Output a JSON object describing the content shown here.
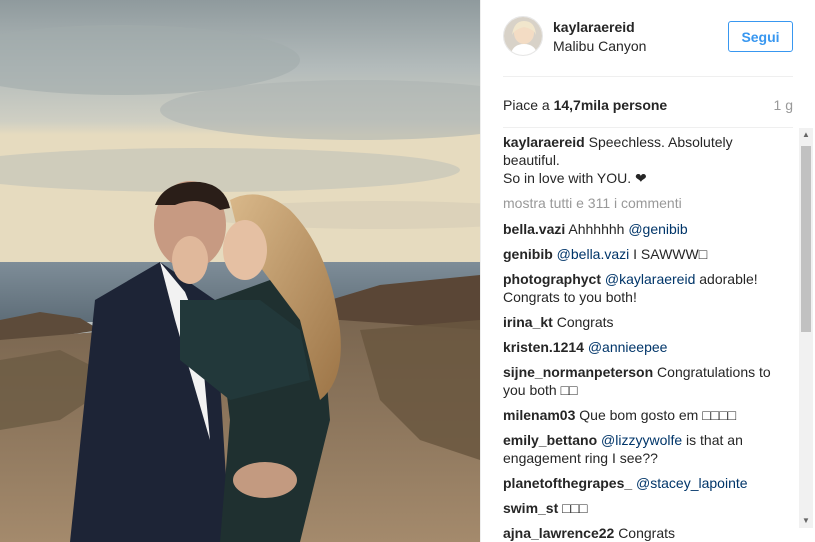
{
  "header": {
    "username": "kaylaraereid",
    "location": "Malibu Canyon",
    "follow_label": "Segui"
  },
  "likes": {
    "prefix": "Piace a ",
    "count": "14,7",
    "suffix": "mila persone",
    "time": "1 g"
  },
  "caption": {
    "user": "kaylaraereid",
    "line1": "Speechless. Absolutely beautiful.",
    "line2": "So in love with YOU.",
    "heart": "❤"
  },
  "show_all_label": "mostra tutti e 311 i commenti",
  "comments": [
    {
      "user": "bella.vazi",
      "text": "Ahhhhhh ",
      "mention": "@genibib",
      "after": ""
    },
    {
      "user": "genibib",
      "text": "",
      "mention": "@bella.vazi",
      "after": " I SAWWW□"
    },
    {
      "user": "photographyct",
      "text": "",
      "mention": "@kaylaraereid",
      "after": " adorable! Congrats to you both!"
    },
    {
      "user": "irina_kt",
      "text": "Congrats",
      "mention": "",
      "after": ""
    },
    {
      "user": "kristen.1214",
      "text": "",
      "mention": "@annieepee",
      "after": ""
    },
    {
      "user": "sijne_normanpeterson",
      "text": "Congratulations to you both □□",
      "mention": "",
      "after": ""
    },
    {
      "user": "milenam03",
      "text": "Que bom gosto em □□□□",
      "mention": "",
      "after": ""
    },
    {
      "user": "emily_bettano",
      "text": "",
      "mention": "@lizzyywolfe",
      "after": " is that an engagement ring I see??"
    },
    {
      "user": "planetofthegrapes_",
      "text": "",
      "mention": "@stacey_lapointe",
      "after": ""
    },
    {
      "user": "swim_st",
      "text": "□□□",
      "mention": "",
      "after": ""
    },
    {
      "user": "ajna_lawrence22",
      "text": "Congrats",
      "mention": "",
      "after": ""
    }
  ]
}
